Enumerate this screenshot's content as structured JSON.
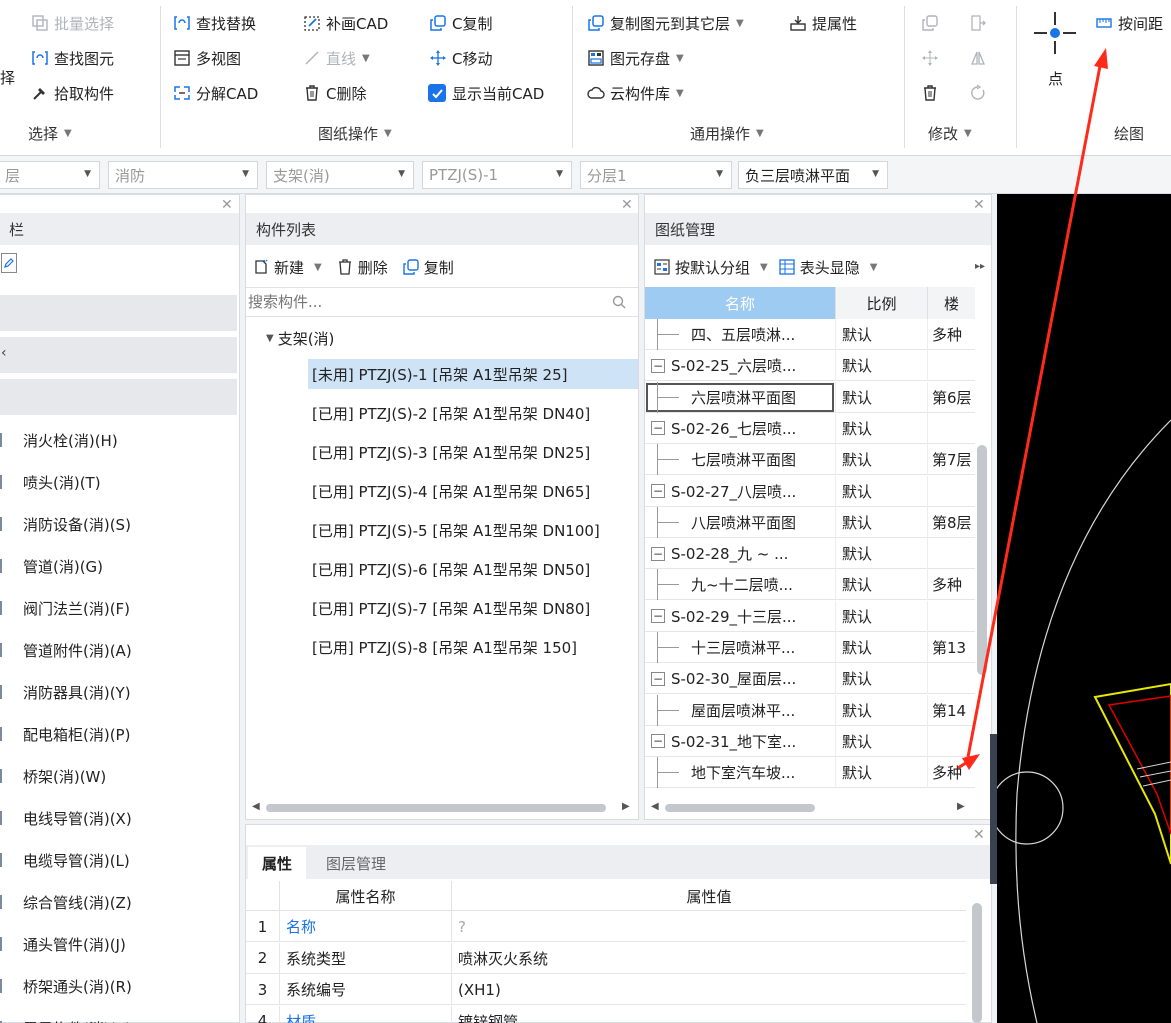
{
  "ribbon": {
    "select_group": {
      "batch_select": "批量选择",
      "find_element": "查找图元",
      "pick_component": "拾取构件",
      "partial_label": "择",
      "group_label": "选择"
    },
    "drawing_ops": {
      "find_replace": "查找替换",
      "multi_view": "多视图",
      "explode_cad": "分解CAD",
      "add_cad": "补画CAD",
      "line": "直线",
      "c_delete": "C删除",
      "c_copy": "C复制",
      "c_move": "C移动",
      "show_current_cad": "显示当前CAD",
      "show_current_cad_checked": true,
      "group_label": "图纸操作"
    },
    "common_ops": {
      "copy_to_layer": "复制图元到其它层",
      "extract_attr": "提属性",
      "element_storage": "图元存盘",
      "cloud_library": "云构件库",
      "group_label": "通用操作"
    },
    "modify": {
      "group_label": "修改"
    },
    "draw": {
      "point": "点",
      "by_distance": "按间距",
      "group_label": "绘图"
    }
  },
  "layerbar": {
    "floor": "层",
    "discipline": "消防",
    "component_type": "支架(消)",
    "component": "PTZJ(S)-1",
    "sublayer": "分层1",
    "drawing": "负三层喷淋平面"
  },
  "nav_panel": {
    "title": "栏",
    "items": [
      "消火栓(消)(H)",
      "喷头(消)(T)",
      "消防设备(消)(S)",
      "管道(消)(G)",
      "阀门法兰(消)(F)",
      "管道附件(消)(A)",
      "消防器具(消)(Y)",
      "配电箱柜(消)(P)",
      "桥架(消)(W)",
      "电线导管(消)(X)",
      "电缆导管(消)(L)",
      "综合管线(消)(Z)",
      "通头管件(消)(J)",
      "桥架通头(消)(R)",
      "零星构件(消)(K)"
    ]
  },
  "component_list": {
    "title": "构件列表",
    "new_label": "新建",
    "delete_label": "删除",
    "copy_label": "复制",
    "search_placeholder": "搜索构件...",
    "folder": "支架(消)",
    "items": [
      "[未用] PTZJ(S)-1 [吊架 A1型吊架 25]",
      "[已用] PTZJ(S)-2 [吊架 A1型吊架 DN40]",
      "[已用] PTZJ(S)-3 [吊架 A1型吊架 DN25]",
      "[已用] PTZJ(S)-4 [吊架 A1型吊架 DN65]",
      "[已用] PTZJ(S)-5 [吊架 A1型吊架 DN100]",
      "[已用] PTZJ(S)-6 [吊架 A1型吊架 DN50]",
      "[已用] PTZJ(S)-7 [吊架 A1型吊架 DN80]",
      "[已用] PTZJ(S)-8 [吊架 A1型吊架 150]"
    ]
  },
  "drawing_manager": {
    "title": "图纸管理",
    "group_default": "按默认分组",
    "header_toggle": "表头显隐",
    "columns": [
      "名称",
      "比例",
      "楼"
    ],
    "rows": [
      {
        "type": "child",
        "name": "四、五层喷淋...",
        "scale": "默认",
        "floor": "多种"
      },
      {
        "type": "parent",
        "name": "S-02-25_六层喷...",
        "scale": "默认",
        "floor": ""
      },
      {
        "type": "child",
        "name": "六层喷淋平面图",
        "scale": "默认",
        "floor": "第6层"
      },
      {
        "type": "parent",
        "name": "S-02-26_七层喷...",
        "scale": "默认",
        "floor": ""
      },
      {
        "type": "child",
        "name": "七层喷淋平面图",
        "scale": "默认",
        "floor": "第7层"
      },
      {
        "type": "parent",
        "name": "S-02-27_八层喷...",
        "scale": "默认",
        "floor": ""
      },
      {
        "type": "child",
        "name": "八层喷淋平面图",
        "scale": "默认",
        "floor": "第8层"
      },
      {
        "type": "parent",
        "name": "S-02-28_九 ~ ...",
        "scale": "默认",
        "floor": ""
      },
      {
        "type": "child",
        "name": "九~十二层喷...",
        "scale": "默认",
        "floor": "多种"
      },
      {
        "type": "parent",
        "name": "S-02-29_十三层...",
        "scale": "默认",
        "floor": ""
      },
      {
        "type": "child",
        "name": "十三层喷淋平...",
        "scale": "默认",
        "floor": "第13"
      },
      {
        "type": "parent",
        "name": "S-02-30_屋面层...",
        "scale": "默认",
        "floor": ""
      },
      {
        "type": "child",
        "name": "屋面层喷淋平...",
        "scale": "默认",
        "floor": "第14"
      },
      {
        "type": "parent",
        "name": "S-02-31_地下室...",
        "scale": "默认",
        "floor": ""
      },
      {
        "type": "child",
        "name": "地下室汽车坡...",
        "scale": "默认",
        "floor": "多种"
      }
    ]
  },
  "properties": {
    "tab_properties": "属性",
    "tab_layers": "图层管理",
    "col_name": "属性名称",
    "col_value": "属性值",
    "rows": [
      {
        "idx": "1",
        "name": "名称",
        "value": "?",
        "highlight": true
      },
      {
        "idx": "2",
        "name": "系统类型",
        "value": "喷淋灭火系统",
        "highlight": false
      },
      {
        "idx": "3",
        "name": "系统编号",
        "value": "(XH1)",
        "highlight": false
      },
      {
        "idx": "4",
        "name": "材质",
        "value": "镀锌钢管",
        "highlight": true
      }
    ]
  },
  "colors": {
    "accent": "#1a73e8",
    "selection": "#cfe3f7",
    "header_blue": "#9ecbf2",
    "annotation_red": "#ff2a1a",
    "canvas_bg": "#000000",
    "cad_yellow": "#e8e800",
    "cad_red": "#e00000"
  },
  "icons": [
    "batch-select-icon",
    "find-element-icon",
    "pick-icon",
    "find-replace-icon",
    "multi-view-icon",
    "explode-icon",
    "add-cad-icon",
    "line-icon",
    "trash-icon",
    "copy-icon",
    "move-icon",
    "checkbox-icon",
    "storage-icon",
    "cloud-icon",
    "point-icon",
    "ruler-icon",
    "search-icon",
    "edit-icon",
    "table-icon",
    "group-icon",
    "close-icon"
  ]
}
